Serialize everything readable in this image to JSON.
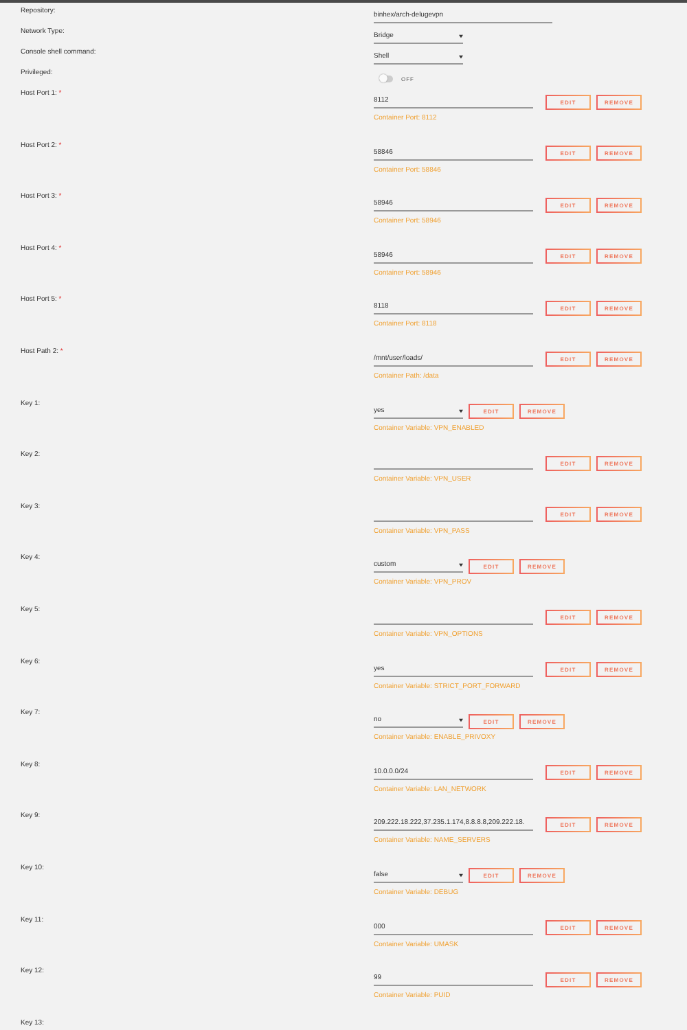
{
  "settings": [
    {
      "kind": "text",
      "label": "Repository:",
      "value": "binhex/arch-delugevpn"
    },
    {
      "kind": "select",
      "label": "Network Type:",
      "value": "Bridge"
    },
    {
      "kind": "select",
      "label": "Console shell command:",
      "value": "Shell"
    },
    {
      "kind": "toggle",
      "label": "Privileged:",
      "on": false,
      "state_label": "OFF"
    }
  ],
  "mappings": [
    {
      "label": "Host Port 1:",
      "required_mark": "*",
      "kind": "text",
      "value": "8112",
      "hint": "Container Port: 8112",
      "buttons": [
        "EDIT",
        "REMOVE"
      ]
    },
    {
      "label": "Host Port 2:",
      "required_mark": "*",
      "kind": "text",
      "value": "58846",
      "hint": "Container Port: 58846",
      "buttons": [
        "EDIT",
        "REMOVE"
      ]
    },
    {
      "label": "Host Port 3:",
      "required_mark": "*",
      "kind": "text",
      "value": "58946",
      "hint": "Container Port: 58946",
      "buttons": [
        "EDIT",
        "REMOVE"
      ]
    },
    {
      "label": "Host Port 4:",
      "required_mark": "*",
      "kind": "text",
      "value": "58946",
      "hint": "Container Port: 58946",
      "buttons": [
        "EDIT",
        "REMOVE"
      ]
    },
    {
      "label": "Host Port 5:",
      "required_mark": "*",
      "kind": "text",
      "value": "8118",
      "hint": "Container Port: 8118",
      "buttons": [
        "EDIT",
        "REMOVE"
      ]
    },
    {
      "label": "Host Path 2:",
      "required_mark": "*",
      "kind": "text",
      "value": "/mnt/user/loads/",
      "hint": "Container Path: /data",
      "buttons": [
        "EDIT",
        "REMOVE"
      ]
    },
    {
      "label": "Key 1:",
      "kind": "select",
      "value": "yes",
      "hint": "Container Variable: VPN_ENABLED",
      "buttons": [
        "EDIT",
        "REMOVE"
      ]
    },
    {
      "label": "Key 2:",
      "kind": "text",
      "hint": "Container Variable: VPN_USER",
      "buttons": [
        "EDIT",
        "REMOVE"
      ]
    },
    {
      "label": "Key 3:",
      "kind": "text",
      "hint": "Container Variable: VPN_PASS",
      "buttons": [
        "EDIT",
        "REMOVE"
      ]
    },
    {
      "label": "Key 4:",
      "kind": "select",
      "value": "custom",
      "hint": "Container Variable: VPN_PROV",
      "buttons": [
        "EDIT",
        "REMOVE"
      ]
    },
    {
      "label": "Key 5:",
      "kind": "text",
      "hint": "Container Variable: VPN_OPTIONS",
      "buttons": [
        "EDIT",
        "REMOVE"
      ]
    },
    {
      "label": "Key 6:",
      "kind": "text",
      "value": "yes",
      "hint": "Container Variable: STRICT_PORT_FORWARD",
      "buttons": [
        "EDIT",
        "REMOVE"
      ]
    },
    {
      "label": "Key 7:",
      "kind": "select",
      "value": "no",
      "hint": "Container Variable: ENABLE_PRIVOXY",
      "buttons": [
        "EDIT",
        "REMOVE"
      ]
    },
    {
      "label": "Key 8:",
      "kind": "text",
      "value": "10.0.0.0/24",
      "hint": "Container Variable: LAN_NETWORK",
      "buttons": [
        "EDIT",
        "REMOVE"
      ]
    },
    {
      "label": "Key 9:",
      "kind": "text",
      "value": "209.222.18.222,37.235.1.174,8.8.8.8,209.222.18.",
      "hint": "Container Variable: NAME_SERVERS",
      "buttons": [
        "EDIT",
        "REMOVE"
      ]
    },
    {
      "label": "Key 10:",
      "kind": "select",
      "value": "false",
      "hint": "Container Variable: DEBUG",
      "buttons": [
        "EDIT",
        "REMOVE"
      ]
    },
    {
      "label": "Key 11:",
      "kind": "text",
      "value": "000",
      "hint": "Container Variable: UMASK",
      "buttons": [
        "EDIT",
        "REMOVE"
      ]
    },
    {
      "label": "Key 12:",
      "kind": "text",
      "value": "99",
      "hint": "Container Variable: PUID",
      "buttons": [
        "EDIT",
        "REMOVE"
      ]
    },
    {
      "label": "Key 13:"
    }
  ]
}
